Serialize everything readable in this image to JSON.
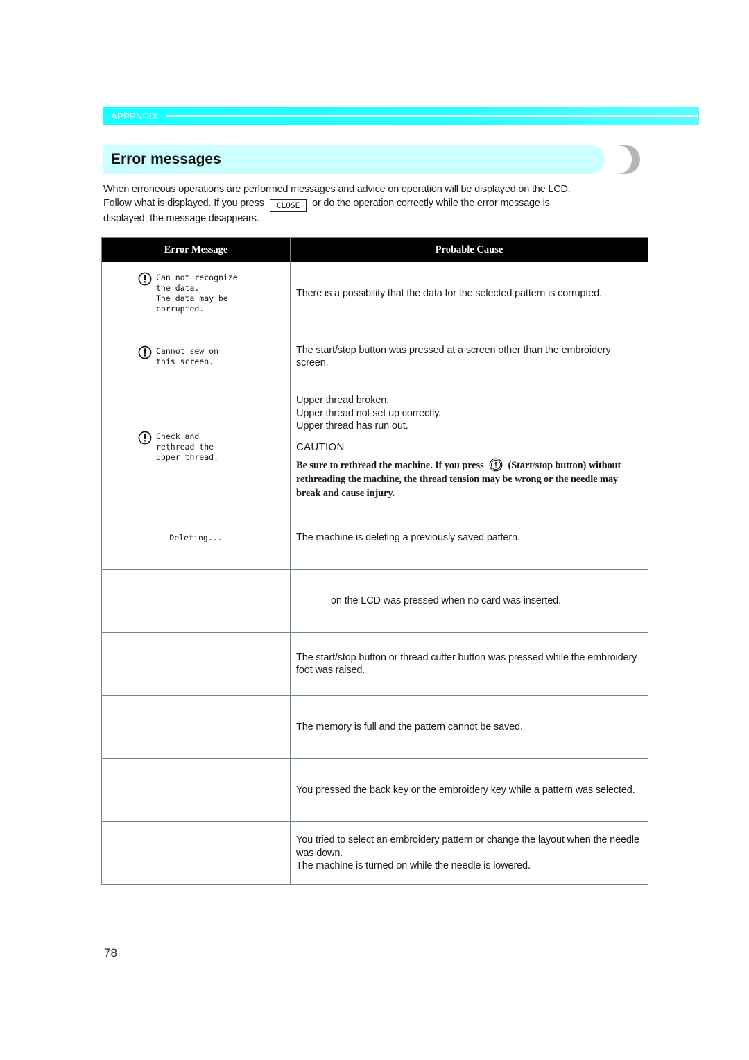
{
  "header": {
    "section_label": "APPENDIX",
    "accent_color": "#16ffff"
  },
  "heading": {
    "title": "Error messages",
    "background_color": "#ccffff"
  },
  "intro": {
    "line1": "When erroneous operations are performed messages and advice on operation will be displayed on the LCD.",
    "line2_before_key": "Follow what is displayed. If you press",
    "close_key_label": "CLOSE",
    "line2_after_key": "or do the operation correctly while the error message is",
    "line3": "displayed, the message disappears."
  },
  "table": {
    "headers": {
      "error_message": "Error Message",
      "probable_cause": "Probable Cause"
    },
    "rows": [
      {
        "icon": "warning-icon",
        "message": "Can not recognize\nthe data.\nThe data may be\ncorrupted.",
        "cause": [
          "There is a possibility that the data for the selected pattern is corrupted."
        ]
      },
      {
        "icon": "warning-icon",
        "message": "Cannot sew on\nthis screen.",
        "cause": [
          "The start/stop button was pressed at a screen other than the embroidery screen."
        ]
      },
      {
        "icon": "warning-icon",
        "message": "Check and\nrethread the\nupper thread.",
        "cause": [
          "Upper thread broken.",
          "Upper thread not set up correctly.",
          "Upper thread has run out."
        ],
        "caution_title": "CAUTION",
        "caution_before_icon": "Be sure to rethread the machine. If you press",
        "caution_icon": "start-stop-button-icon",
        "caution_after_icon": "(Start/stop button) without rethreading the machine, the thread tension may be wrong or the needle may break and cause injury."
      },
      {
        "icon": "",
        "message": "Deleting...",
        "cause": [
          "The machine is deleting a previously saved pattern."
        ]
      },
      {
        "icon": "",
        "message": "",
        "cause": [
          "on the LCD was pressed when no card was inserted."
        ]
      },
      {
        "icon": "",
        "message": "",
        "cause": [
          "The start/stop button or thread cutter button was pressed while the embroidery foot was raised."
        ]
      },
      {
        "icon": "",
        "message": "",
        "cause": [
          "The memory is full and the pattern cannot be saved."
        ]
      },
      {
        "icon": "",
        "message": "",
        "cause": [
          "You pressed the back key or the embroidery key while a pattern was selected."
        ]
      },
      {
        "icon": "",
        "message": "",
        "cause": [
          "You tried to select an embroidery pattern or change the layout when the needle was down.",
          "The machine is turned on while the needle is lowered."
        ]
      }
    ]
  },
  "footer": {
    "page_number": "78"
  }
}
